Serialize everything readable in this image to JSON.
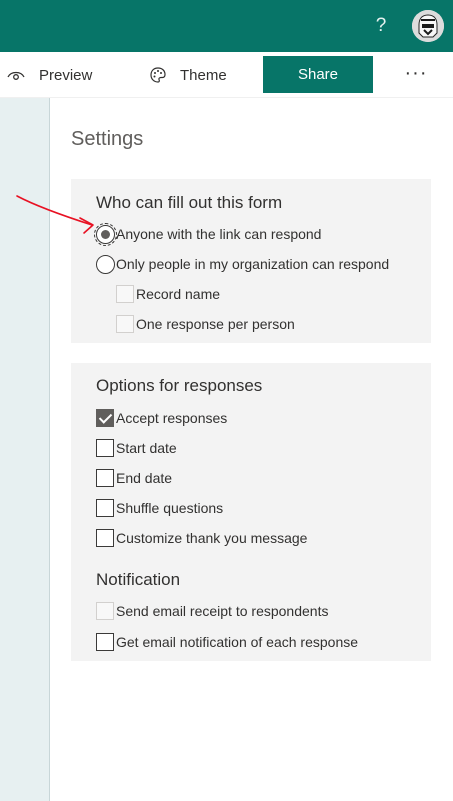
{
  "header": {
    "help_icon": "?",
    "avatar": "stormtrooper-avatar",
    "brand_color": "#077568"
  },
  "commands": {
    "preview": "Preview",
    "theme": "Theme",
    "share": "Share",
    "more": "···"
  },
  "settings": {
    "title": "Settings",
    "who": {
      "heading": "Who can fill out this form",
      "anyone": "Anyone with the link can respond",
      "org_only": "Only people in my organization can respond",
      "record_name": "Record name",
      "one_response": "One response per person",
      "selected": "anyone"
    },
    "options": {
      "heading": "Options for responses",
      "accept": "Accept responses",
      "start_date": "Start date",
      "end_date": "End date",
      "shuffle": "Shuffle questions",
      "thanks": "Customize thank you message",
      "checked": [
        "accept"
      ]
    },
    "notification": {
      "heading": "Notification",
      "email_receipt": "Send email receipt to respondents",
      "email_notify": "Get email notification of each response"
    }
  },
  "annotation": {
    "arrow_color": "#e81123"
  }
}
